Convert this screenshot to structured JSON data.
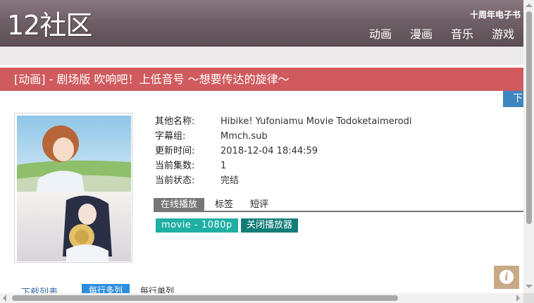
{
  "header": {
    "logo": "12社区",
    "tagline": "十周年电子书",
    "nav": [
      "动画",
      "漫画",
      "音乐",
      "游戏"
    ]
  },
  "title": "[动画] - 剧场版 吹响吧！上低音号 ～想要传达的旋律～",
  "download_tab": "下载",
  "details": [
    {
      "label": "其他名称:",
      "value": "Hibike! Yufoniamu Movie Todoketaimerodi"
    },
    {
      "label": "字幕组:",
      "value": "Mmch.sub"
    },
    {
      "label": "更新时间:",
      "value": "2018-12-04 18:44:59"
    },
    {
      "label": "当前集数:",
      "value": "1"
    },
    {
      "label": "当前状态:",
      "value": "完结"
    }
  ],
  "tabs": [
    "在线播放",
    "标签",
    "短评"
  ],
  "buttons": {
    "episode": "movie - 1080p",
    "close_player": "关闭播放器"
  },
  "bottom": {
    "download_list": "下载列表",
    "per_line_multi": "每行多列",
    "per_line_single": "每行单列"
  },
  "colors": {
    "header": "#6f5f66",
    "title_bar": "#d05a5e",
    "episode_button": "#1fb0a4",
    "close_button": "#127d78",
    "download_tab": "#3f86c0",
    "info_button": "#c9aa86"
  },
  "icons": {
    "info": "info-icon"
  }
}
